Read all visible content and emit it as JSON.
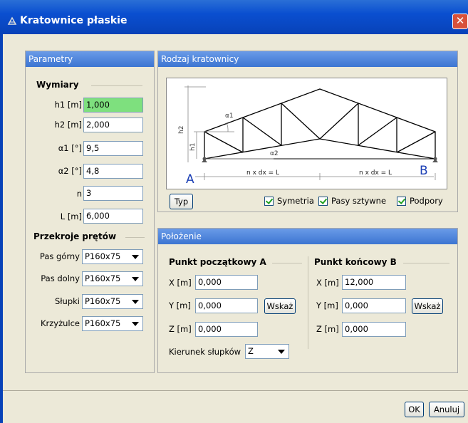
{
  "window": {
    "title": "Kratownice płaskie",
    "close_glyph": "✕"
  },
  "params": {
    "header": "Parametry",
    "dims_title": "Wymiary",
    "fields": [
      {
        "label": "h1 [m]",
        "value": "1,000"
      },
      {
        "label": "h2 [m]",
        "value": "2,000"
      },
      {
        "label": "α1 [°]",
        "value": "9,5"
      },
      {
        "label": "α2 [°]",
        "value": "4,8"
      },
      {
        "label": "n",
        "value": "3"
      },
      {
        "label": "L [m]",
        "value": "6,000"
      }
    ],
    "sections_title": "Przekroje prętów",
    "sections": [
      {
        "label": "Pas górny",
        "value": "P160x75"
      },
      {
        "label": "Pas dolny",
        "value": "P160x75"
      },
      {
        "label": "Słupki",
        "value": "P160x75"
      },
      {
        "label": "Krzyżulce",
        "value": "P160x75"
      }
    ]
  },
  "truss": {
    "header": "Rodzaj kratownicy",
    "diagram": {
      "label_a": "A",
      "label_b": "B",
      "alpha1": "α1",
      "alpha2": "α2",
      "h1": "h1",
      "h2": "h2",
      "span_left": "n x dx = L",
      "span_right": "n x dx = L"
    },
    "type_button": "Typ",
    "checkboxes": [
      {
        "label": "Symetria",
        "checked": true
      },
      {
        "label": "Pasy sztywne",
        "checked": true
      },
      {
        "label": "Podpory",
        "checked": true
      }
    ]
  },
  "position": {
    "header": "Położenie",
    "start": {
      "title": "Punkt początkowy A",
      "x_label": "X [m]",
      "x": "0,000",
      "y_label": "Y [m]",
      "y": "0,000",
      "z_label": "Z [m]",
      "z": "0,000",
      "point_button": "Wskaż"
    },
    "end": {
      "title": "Punkt końcowy B",
      "x_label": "X [m]",
      "x": "12,000",
      "y_label": "Y [m]",
      "y": "0,000",
      "z_label": "Z [m]",
      "z": "0,000",
      "point_button": "Wskaż"
    },
    "direction_label": "Kierunek słupków",
    "direction_value": "Z"
  },
  "footer": {
    "ok": "OK",
    "cancel": "Anuluj"
  },
  "colors": {
    "title_bar": "#0a4fd0",
    "panel_header": "#3c75d2",
    "highlight_input": "#7ee07e",
    "client_bg": "#ece9d8"
  }
}
